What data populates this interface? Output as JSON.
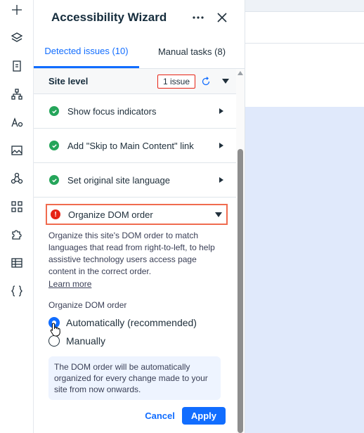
{
  "panel": {
    "title": "Accessibility Wizard",
    "more_icon": "more-dots-icon",
    "close_icon": "close-icon"
  },
  "tabs": [
    {
      "label": "Detected issues (10)",
      "active": true
    },
    {
      "label": "Manual tasks (8)",
      "active": false
    }
  ],
  "site_level": {
    "label": "Site level",
    "badge": "1 issue"
  },
  "issues": [
    {
      "label": "Show focus indicators",
      "status": "resolved"
    },
    {
      "label": "Add \"Skip to Main Content\" link",
      "status": "resolved"
    },
    {
      "label": "Set original site language",
      "status": "resolved"
    }
  ],
  "open_issue": {
    "label": "Organize DOM order",
    "status_icon": "!",
    "description": "Organize this site's DOM order to match languages that read from right-to-left, to help assistive technology users access page content in the correct order.",
    "learn_more": "Learn more",
    "option_label": "Organize DOM order",
    "options": [
      {
        "label": "Automatically (recommended)",
        "selected": true
      },
      {
        "label": "Manually",
        "selected": false
      }
    ],
    "info": "The DOM order will be automatically organized for every change made to your site from now onwards.",
    "cancel": "Cancel",
    "apply": "Apply"
  },
  "colors": {
    "accent": "#116dff",
    "success": "#25a55a",
    "error": "#e62214",
    "highlight_border": "#f06b4f"
  },
  "rail_icons": [
    "plus-icon",
    "layers-icon",
    "page-icon",
    "sitemap-icon",
    "fonts-icon",
    "image-icon",
    "apps-icon",
    "grid-icon",
    "puzzle-icon",
    "table-icon",
    "code-braces-icon"
  ]
}
